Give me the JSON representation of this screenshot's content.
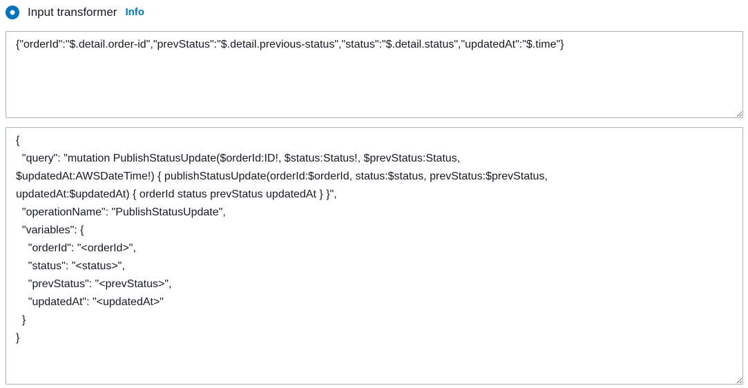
{
  "input_transformer_section": {
    "radio": {
      "label": "Input transformer",
      "info_label": "Info",
      "checked": true
    },
    "textareas": {
      "input_path": "{\"orderId\":\"$.detail.order-id\",\"prevStatus\":\"$.detail.previous-status\",\"status\":\"$.detail.status\",\"updatedAt\":\"$.time\"}",
      "template": "{\n  \"query\": \"mutation PublishStatusUpdate($orderId:ID!, $status:Status!, $prevStatus:Status,\n$updatedAt:AWSDateTime!) { publishStatusUpdate(orderId:$orderId, status:$status, prevStatus:$prevStatus,\nupdatedAt:$updatedAt) { orderId status prevStatus updatedAt } }\",\n  \"operationName\": \"PublishStatusUpdate\",\n  \"variables\": {\n    \"orderId\": \"<orderId>\",\n    \"status\": \"<status>\",\n    \"prevStatus\": \"<prevStatus>\",\n    \"updatedAt\": \"<updatedAt>\"\n  }\n}"
    },
    "colors": {
      "accent_blue": "#0073bb",
      "border_gray": "#aab4b8",
      "text_dark": "#16191f"
    }
  }
}
